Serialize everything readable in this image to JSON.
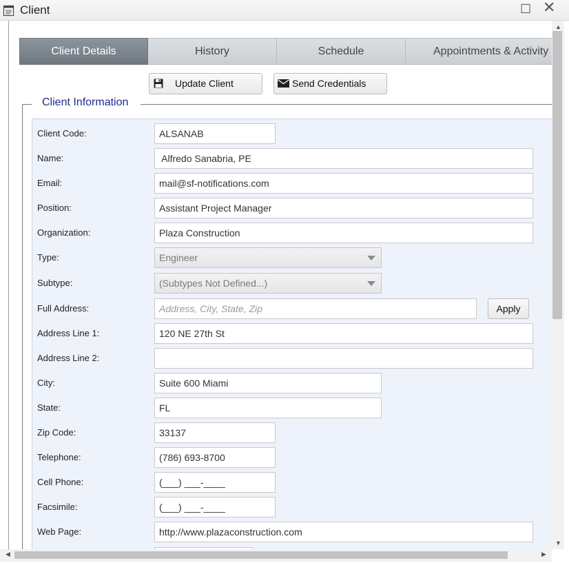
{
  "window": {
    "title": "Client",
    "icon": "form-window-icon",
    "maximize_icon": "maximize-icon",
    "close_icon": "close-icon"
  },
  "tabs": [
    {
      "label": "Client Details",
      "active": true
    },
    {
      "label": "History",
      "active": false
    },
    {
      "label": "Schedule",
      "active": false
    },
    {
      "label": "Appointments & Activity",
      "active": false
    }
  ],
  "toolbar": {
    "update_label": "Update Client",
    "update_icon": "floppy-disk-icon",
    "send_label": "Send Credentials",
    "send_icon": "envelope-icon"
  },
  "section": {
    "legend": "Client Information"
  },
  "fields": {
    "client_code": {
      "label": "Client Code:",
      "value": "ALSANAB"
    },
    "name": {
      "label": "Name:",
      "value": " Alfredo Sanabria, PE"
    },
    "email": {
      "label": "Email:",
      "value": "mail@sf-notifications.com"
    },
    "position": {
      "label": "Position:",
      "value": "Assistant Project Manager"
    },
    "organization": {
      "label": "Organization:",
      "value": "Plaza Construction"
    },
    "type": {
      "label": "Type:",
      "value": "Engineer"
    },
    "subtype": {
      "label": "Subtype:",
      "value": "(Subtypes Not Defined...)"
    },
    "full_address": {
      "label": "Full Address:",
      "value": "",
      "placeholder": "Address, City, State, Zip",
      "apply_label": "Apply"
    },
    "address1": {
      "label": "Address Line 1:",
      "value": "120 NE 27th St"
    },
    "address2": {
      "label": "Address Line 2:",
      "value": ""
    },
    "city": {
      "label": "City:",
      "value": "Suite 600 Miami"
    },
    "state": {
      "label": "State:",
      "value": "FL"
    },
    "zip": {
      "label": "Zip Code:",
      "value": "33137"
    },
    "telephone": {
      "label": "Telephone:",
      "value": "(786) 693-8700"
    },
    "cell": {
      "label": "Cell Phone:",
      "value": "(___) ___-____"
    },
    "fax": {
      "label": "Facsimile:",
      "value": "(___) ___-____"
    },
    "web": {
      "label": "Web Page:",
      "value": "http://www.plazaconstruction.com"
    }
  }
}
